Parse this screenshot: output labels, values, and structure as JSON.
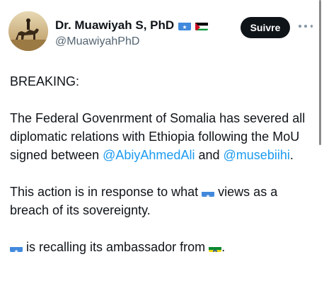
{
  "author": {
    "name": "Dr. Muawiyah S, PhD",
    "handle": "@MuawiyahPhD",
    "name_flags": [
      "somalia-flag",
      "palestine-flag"
    ]
  },
  "actions": {
    "follow_label": "Suivre",
    "more_icon": "more-horizontal-icon"
  },
  "tweet": {
    "heading": "BREAKING:",
    "para1_text": "The Federal Govenrment of Somalia has severed all diplomatic relations with Ethiopia following the MoU signed between",
    "mention1": "@AbiyAhmedAli",
    "connector": "and",
    "mention2": "@musebiihi",
    "para1_end": ".",
    "para2_before": "This action is in response to what",
    "para2_after": "views as a breach of its sovereignty.",
    "para3_text": "is recalling its ambassador from",
    "para3_end": "."
  },
  "colors": {
    "link": "#1d9bf0",
    "text": "#0f1419",
    "secondary": "#536471",
    "button_bg": "#0f1419",
    "somalia_blue": "#4189dd",
    "ethiopia_green": "#078930",
    "ethiopia_yellow": "#fcdd09",
    "ethiopia_red": "#da121a"
  }
}
